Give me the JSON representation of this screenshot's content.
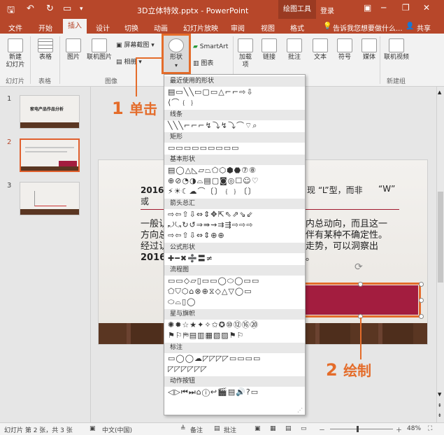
{
  "titlebar": {
    "doc_title": "3D立体特效.pptx - PowerPoint",
    "drawing_tools": "绘图工具",
    "login": "登录"
  },
  "tabs": [
    "文件",
    "开始",
    "插入",
    "设计",
    "切换",
    "动画",
    "幻灯片放映",
    "审阅",
    "视图",
    "格式"
  ],
  "tell_me": "告诉我您想要做什么...",
  "share": "共享",
  "ribbon": {
    "new_slide": "新建\n幻灯片",
    "new_slide_a": "新建",
    "new_slide_b": "幻灯片",
    "table": "表格",
    "picture": "图片",
    "online_picture": "联机图片",
    "screenshot": "屏幕截图",
    "album": "相册",
    "shapes": "形状",
    "smartart": "SmartArt",
    "chart": "图表",
    "addin": "加载",
    "addin2": "项",
    "links": "链接",
    "comment": "批注",
    "text": "文本",
    "symbol": "符号",
    "media": "媒体",
    "online_video": "联机视频",
    "groups": {
      "slides": "幻灯片",
      "table": "表格",
      "image": "图像",
      "new_group": "新建组"
    }
  },
  "thumbnails": [
    {
      "num": "1",
      "text": "家电产品作品分析"
    },
    {
      "num": "2"
    },
    {
      "num": "3"
    }
  ],
  "slide": {
    "line1": "2016年",
    "line1_mid": "现",
    "line1_quote": "“L”型，而非",
    "line1_w": "“W”",
    "line2": "或",
    "para1": "一般认",
    "para1b": "内总动向，而且这一",
    "para2": "方向总",
    "para2b": "伴有某种不确定性。",
    "para3": "经过认",
    "para3b": "走势，可以洞察出",
    "para4": "2016年",
    "para4b": "。"
  },
  "shapes_menu": {
    "categories": [
      {
        "key": "recent",
        "label": "最近使用的形状"
      },
      {
        "key": "lines",
        "label": "线条"
      },
      {
        "key": "rect",
        "label": "矩形"
      },
      {
        "key": "basic",
        "label": "基本形状"
      },
      {
        "key": "arrows",
        "label": "箭头总汇"
      },
      {
        "key": "equation",
        "label": "公式形状"
      },
      {
        "key": "flowchart",
        "label": "流程图"
      },
      {
        "key": "stars",
        "label": "星与旗帜"
      },
      {
        "key": "callouts",
        "label": "标注"
      },
      {
        "key": "actions",
        "label": "动作按钮"
      }
    ]
  },
  "annotations": {
    "step1_num": "1",
    "step1_text": "单击",
    "step2_num": "2",
    "step2_text": "绘制"
  },
  "statusbar": {
    "slide_info": "幻灯片 第 2 张，共 3 张",
    "language": "中文(中国)",
    "notes": "备注",
    "comments": "批注",
    "zoom": "48%"
  },
  "colors": {
    "accent": "#b7472a",
    "shape_fill": "#a31d3f",
    "annotation": "#e46c2a"
  }
}
